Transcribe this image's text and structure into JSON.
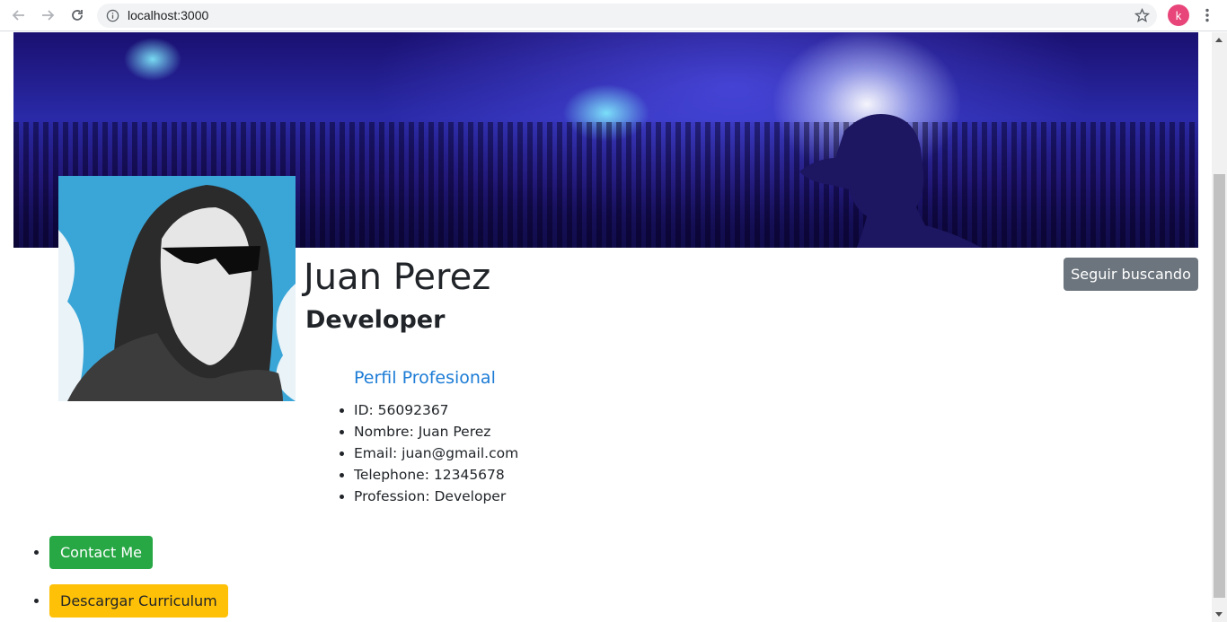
{
  "browser": {
    "url": "localhost:3000",
    "avatar_letter": "k",
    "avatar_color": "#e8457a"
  },
  "profile": {
    "name": "Juan Perez",
    "role": "Developer",
    "follow_button": "Seguir buscando"
  },
  "perfil": {
    "title": "Perfil Profesional",
    "items": [
      "ID: 56092367",
      "Nombre: Juan Perez",
      "Email: juan@gmail.com",
      "Telephone: 12345678",
      "Profession: Developer"
    ]
  },
  "actions": {
    "contact": "Contact Me",
    "download": "Descargar Curriculum"
  },
  "colors": {
    "contact": "#28a745",
    "download": "#ffc107",
    "follow": "#6c757d",
    "link": "#1c7cd6"
  }
}
